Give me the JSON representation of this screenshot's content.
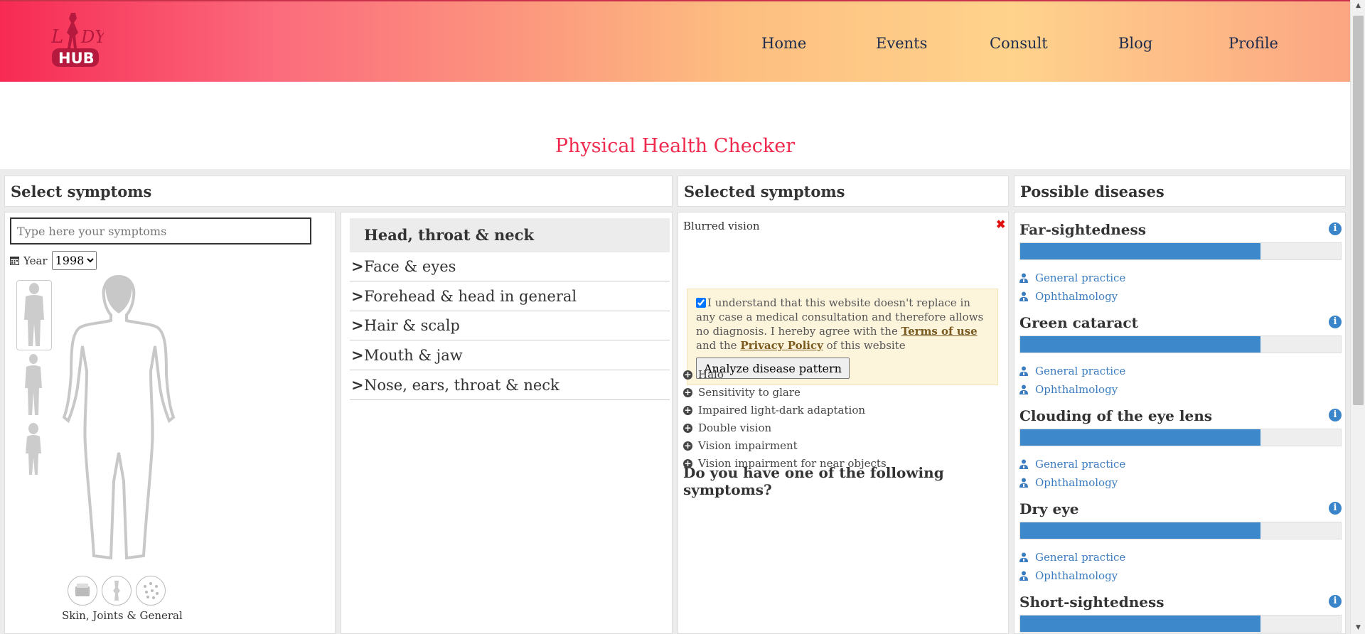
{
  "header": {
    "logo_alt": "Lady Hub",
    "nav": [
      "Home",
      "Events",
      "Consult",
      "Blog",
      "Profile"
    ]
  },
  "page": {
    "title": "Physical Health Checker"
  },
  "select_symptoms": {
    "title": "Select symptoms",
    "search_placeholder": "Type here your symptoms",
    "year_label": "Year",
    "year_value": "1998",
    "caption": "Skin, Joints & General",
    "categories_header": "Head, throat & neck",
    "categories": [
      "Face & eyes",
      "Forehead & head in general",
      "Hair & scalp",
      "Mouth & jaw",
      "Nose, ears, throat & neck"
    ]
  },
  "selected_symptoms": {
    "title": "Selected symptoms",
    "items": [
      "Blurred vision"
    ],
    "consent": {
      "text1": "I understand that this website doesn't replace in any case a medical consultation and therefore allows no diagnosis. I hereby agree with the ",
      "terms_link": "Terms of use",
      "text2": " and the ",
      "privacy_link": "Privacy Policy",
      "text3": " of this website",
      "checked": true
    },
    "analyze_button": "Analyze disease pattern",
    "question": "Do you have one of the following symptoms?",
    "suggestions": [
      "Halo",
      "Sensitivity to glare",
      "Impaired light-dark adaptation",
      "Double vision",
      "Vision impairment",
      "Vision impairment for near objects"
    ]
  },
  "possible_diseases": {
    "title": "Possible diseases",
    "items": [
      {
        "name": "Far-sightedness",
        "match": 0.75,
        "specialists": [
          "General practice",
          "Ophthalmology"
        ]
      },
      {
        "name": "Green cataract",
        "match": 0.75,
        "specialists": [
          "General practice",
          "Ophthalmology"
        ]
      },
      {
        "name": "Clouding of the eye lens",
        "match": 0.75,
        "specialists": [
          "General practice",
          "Ophthalmology"
        ]
      },
      {
        "name": "Dry eye",
        "match": 0.75,
        "specialists": [
          "General practice",
          "Ophthalmology"
        ]
      },
      {
        "name": "Short-sightedness",
        "match": 0.75,
        "specialists": []
      }
    ]
  },
  "colors": {
    "accent": "#ef2a4e",
    "bar": "#3d87cb",
    "link": "#3a7cbf"
  }
}
